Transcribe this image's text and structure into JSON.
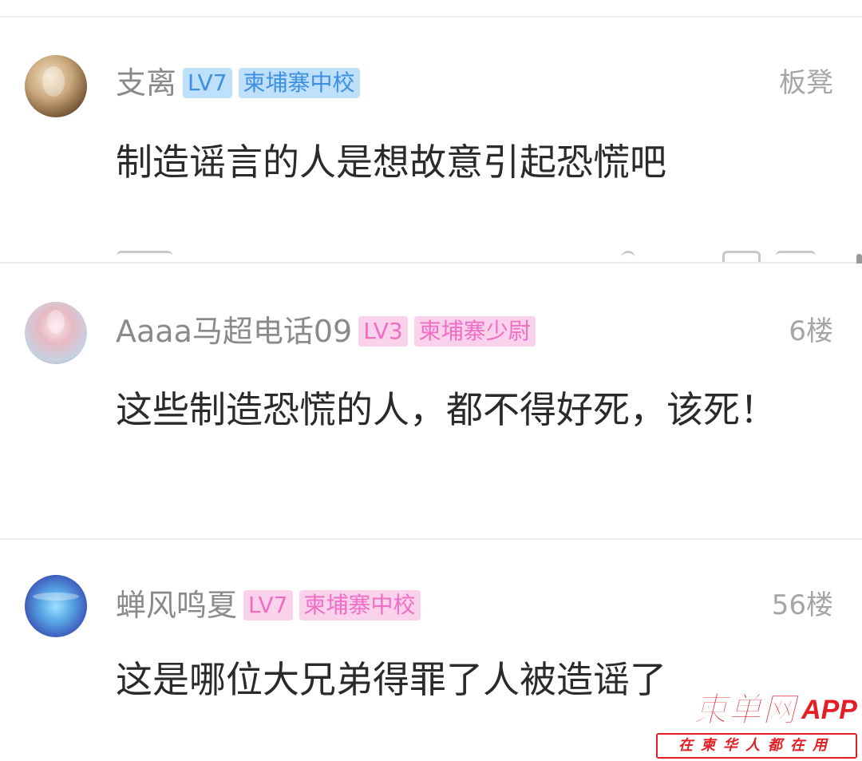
{
  "comments": [
    {
      "username": "支离",
      "level": "LV7",
      "title": "柬埔寨中校",
      "floor": "板凳",
      "text": "制造谣言的人是想故意引起恐慌吧",
      "badge_color": "blue"
    },
    {
      "username": "Aaaa马超电话09",
      "level": "LV3",
      "title": "柬埔寨少尉",
      "floor": "6楼",
      "text": "这些制造恐慌的人，都不得好死，该死！",
      "badge_color": "pink"
    },
    {
      "username": "蝉风鸣夏",
      "level": "LV7",
      "title": "柬埔寨中校",
      "floor": "56楼",
      "text": "这是哪位大兄弟得罪了人被造谣了",
      "badge_color": "pink"
    }
  ],
  "watermark": {
    "brand": "柬单网",
    "app": "APP",
    "slogan": "在柬华人都在用"
  },
  "colors": {
    "badge_blue_bg": "#bfe0fb",
    "badge_blue_text": "#3d8fe0",
    "badge_pink_bg": "#fad2ec",
    "badge_pink_text": "#ef6ec4",
    "brand_red": "#e51d25"
  }
}
